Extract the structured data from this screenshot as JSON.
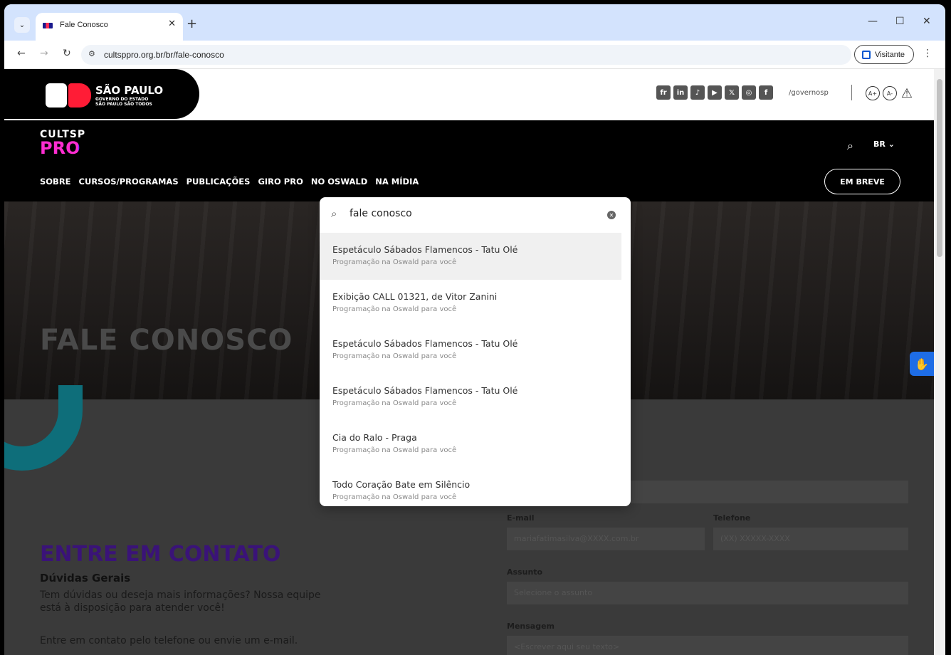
{
  "browser": {
    "tab_title": "Fale Conosco",
    "url": "cultsppro.org.br/br/fale-conosco",
    "profile_label": "Visitante"
  },
  "gov": {
    "name": "SÃO PAULO",
    "line1": "GOVERNO DO ESTADO",
    "line2": "SÃO PAULO SÃO TODOS",
    "handle": "/governosp",
    "social": [
      "fr",
      "in",
      "♪",
      "▶",
      "𝕏",
      "◎",
      "f"
    ],
    "a11y": [
      "A+",
      "A-"
    ]
  },
  "header": {
    "logo_top": "CULTSP",
    "logo_bottom": "PRO",
    "lang": "BR",
    "menu": [
      "SOBRE",
      "CURSOS/PROGRAMAS",
      "PUBLICAÇÕES",
      "GIRO PRO",
      "NO OSWALD",
      "NA MÍDIA"
    ],
    "cta": "EM BREVE"
  },
  "hero": {
    "title": "FALE CONOSCO"
  },
  "contact": {
    "title": "ENTRE EM CONTATO",
    "subtitle": "Dúvidas Gerais",
    "p1": "Tem dúvidas ou deseja mais informações? Nossa equipe está à disposição para atender você!",
    "p2": "Entre em contato pelo telefone ou envie um e-mail.",
    "email_label": "E-mail",
    "email_placeholder": "mariafatimasilva@XXXX.com.br",
    "phone_label": "Telefone",
    "phone_placeholder": "(XX) XXXXX-XXXX",
    "subject_label": "Assunto",
    "subject_placeholder": "Selecione o assunto",
    "message_label": "Mensagem",
    "message_placeholder": "<Escrever aqui seu texto>"
  },
  "search": {
    "query": "fale conosco",
    "results": [
      {
        "title": "Espetáculo Sábados Flamencos - Tatu Olé",
        "sub": "Programação na Oswald para você"
      },
      {
        "title": "Exibição CALL 01321, de Vitor Zanini",
        "sub": "Programação na Oswald para você"
      },
      {
        "title": "Espetáculo Sábados Flamencos - Tatu Olé",
        "sub": "Programação na Oswald para você"
      },
      {
        "title": "Espetáculo Sábados Flamencos - Tatu Olé",
        "sub": "Programação na Oswald para você"
      },
      {
        "title": "Cia do Ralo - Praga",
        "sub": "Programação na Oswald para você"
      },
      {
        "title": "Todo Coração Bate em Silêncio",
        "sub": "Programação na Oswald para você"
      }
    ]
  }
}
